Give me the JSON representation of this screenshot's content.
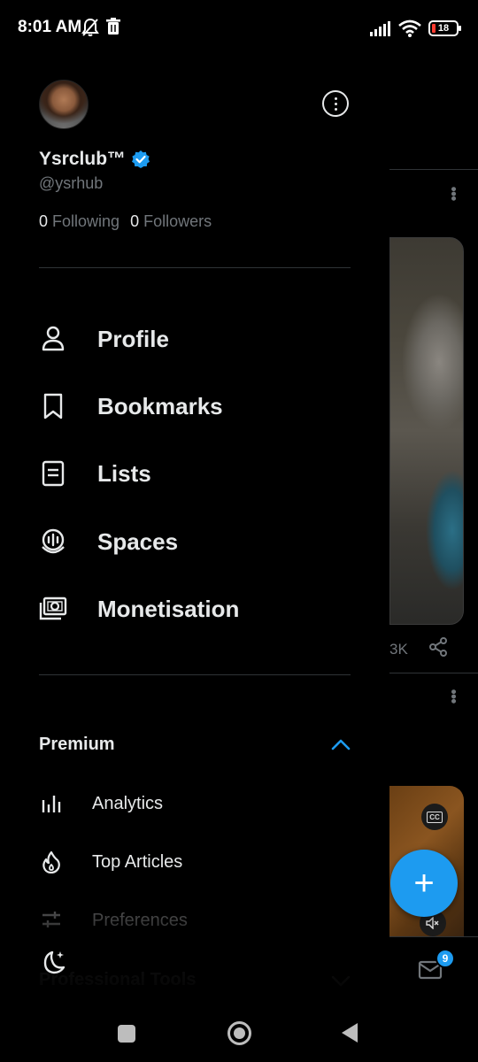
{
  "status_bar": {
    "time": "8:01 AM",
    "battery_level": "18",
    "icons": [
      "muted-bell-icon",
      "trash-icon",
      "signal-icon",
      "wifi-icon",
      "battery-icon"
    ]
  },
  "profile": {
    "display_name": "Ysrclub™",
    "handle": "@ysrhub",
    "following_count": "0",
    "following_label": "Following",
    "followers_count": "0",
    "followers_label": "Followers",
    "verified": true
  },
  "menu": {
    "items": [
      {
        "label": "Profile",
        "icon": "person-icon"
      },
      {
        "label": "Bookmarks",
        "icon": "bookmark-icon"
      },
      {
        "label": "Lists",
        "icon": "list-icon"
      },
      {
        "label": "Spaces",
        "icon": "spaces-mic-icon"
      },
      {
        "label": "Monetisation",
        "icon": "money-icon"
      }
    ]
  },
  "premium": {
    "label": "Premium",
    "expanded": true,
    "items": [
      {
        "label": "Analytics",
        "icon": "bar-chart-icon"
      },
      {
        "label": "Top Articles",
        "icon": "flame-icon"
      },
      {
        "label": "Preferences",
        "icon": "sliders-icon"
      }
    ]
  },
  "professional_tools": {
    "label": "Professional Tools"
  },
  "background": {
    "views_fragment": "3K",
    "mail_badge_count": "9"
  },
  "colors": {
    "accent": "#1d9bf0",
    "background": "#000000",
    "text_primary": "#e7e9ea",
    "text_secondary": "#71767b",
    "divider": "#2f3336"
  }
}
